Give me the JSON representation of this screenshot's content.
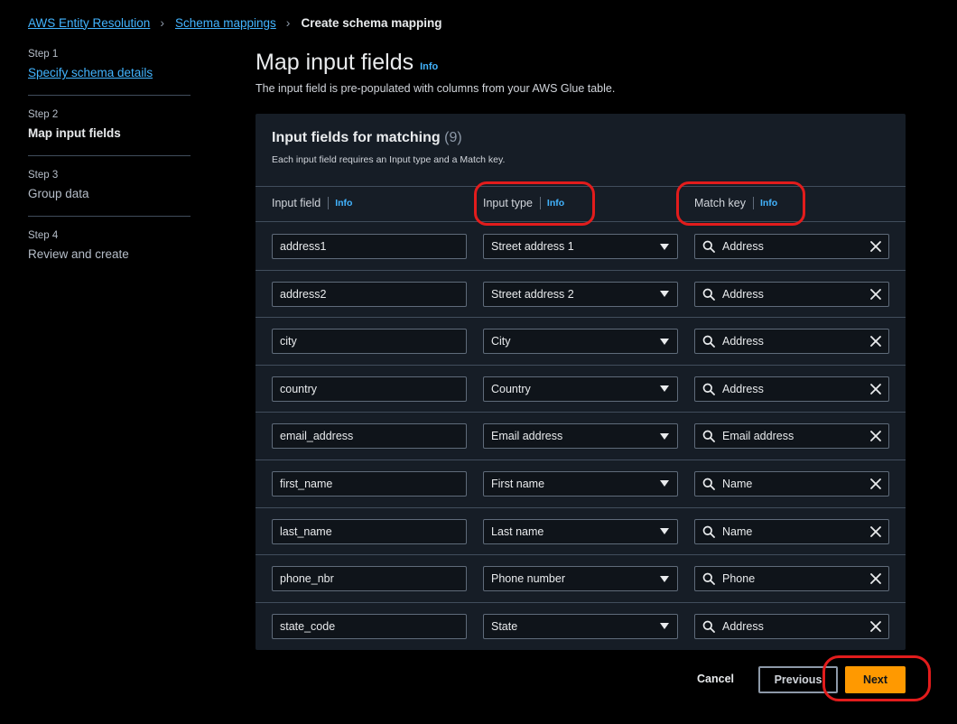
{
  "breadcrumb": {
    "items": [
      "AWS Entity Resolution",
      "Schema mappings"
    ],
    "current": "Create schema mapping"
  },
  "steps": [
    {
      "num": "Step 1",
      "title": "Specify schema details"
    },
    {
      "num": "Step 2",
      "title": "Map input fields"
    },
    {
      "num": "Step 3",
      "title": "Group data"
    },
    {
      "num": "Step 4",
      "title": "Review and create"
    }
  ],
  "header": {
    "title": "Map input fields",
    "info": "Info",
    "description": "The input field is pre-populated with columns from your AWS Glue table."
  },
  "container": {
    "title": "Input fields for matching",
    "count": "(9)",
    "description": "Each input field requires an Input type and a Match key."
  },
  "columns": {
    "input_field": "Input field",
    "input_type": "Input type",
    "match_key": "Match key",
    "info": "Info"
  },
  "rows": [
    {
      "field": "address1",
      "type": "Street address 1",
      "key": "Address"
    },
    {
      "field": "address2",
      "type": "Street address 2",
      "key": "Address"
    },
    {
      "field": "city",
      "type": "City",
      "key": "Address"
    },
    {
      "field": "country",
      "type": "Country",
      "key": "Address"
    },
    {
      "field": "email_address",
      "type": "Email address",
      "key": "Email address"
    },
    {
      "field": "first_name",
      "type": "First name",
      "key": "Name"
    },
    {
      "field": "last_name",
      "type": "Last name",
      "key": "Name"
    },
    {
      "field": "phone_nbr",
      "type": "Phone number",
      "key": "Phone"
    },
    {
      "field": "state_code",
      "type": "State",
      "key": "Address"
    }
  ],
  "footer": {
    "cancel": "Cancel",
    "previous": "Previous",
    "next": "Next"
  },
  "colors": {
    "accent": "#ff9900",
    "link": "#42b4ff",
    "highlight": "#e21c1c"
  }
}
